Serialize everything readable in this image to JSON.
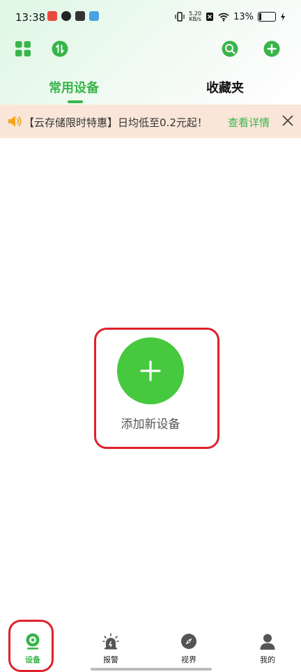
{
  "status_bar": {
    "time": "13:38",
    "net_speed_value": "5.20",
    "net_speed_unit": "KB/s",
    "battery_percent": "13%",
    "battery_level": 0.13
  },
  "toolbar": {
    "left_icons": [
      "grid-icon",
      "swap-icon"
    ],
    "right_icons": [
      "search-icon",
      "add-icon"
    ]
  },
  "tabs": [
    {
      "label": "常用设备",
      "active": true
    },
    {
      "label": "收藏夹",
      "active": false
    }
  ],
  "banner": {
    "text": "【云存储限时特惠】日均低至0.2元起！",
    "link": "查看详情",
    "icon": "speaker-icon",
    "close_icon": "close-icon"
  },
  "main": {
    "add_label": "添加新设备"
  },
  "bottom_nav": [
    {
      "label": "设备",
      "icon": "camera-icon",
      "active": true
    },
    {
      "label": "报警",
      "icon": "alarm-icon",
      "active": false
    },
    {
      "label": "视界",
      "icon": "compass-icon",
      "active": false
    },
    {
      "label": "我的",
      "icon": "user-icon",
      "active": false
    }
  ],
  "colors": {
    "accent": "#39b54a",
    "add_button": "#46c93e",
    "banner_bg": "#f9e6d8",
    "highlight_box": "#e0202a"
  }
}
